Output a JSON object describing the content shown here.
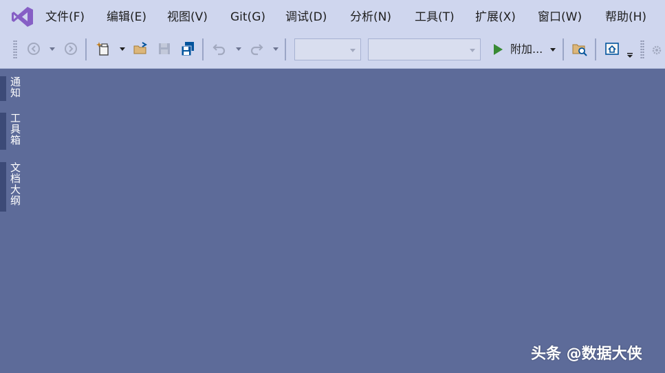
{
  "menu": [
    {
      "id": "file",
      "label": "文件(F)"
    },
    {
      "id": "edit",
      "label": "编辑(E)"
    },
    {
      "id": "view",
      "label": "视图(V)"
    },
    {
      "id": "git",
      "label": "Git(G)"
    },
    {
      "id": "debug",
      "label": "调试(D)"
    },
    {
      "id": "analyze",
      "label": "分析(N)"
    },
    {
      "id": "tools",
      "label": "工具(T)"
    },
    {
      "id": "extensions",
      "label": "扩展(X)"
    },
    {
      "id": "window",
      "label": "窗口(W)"
    },
    {
      "id": "help",
      "label": "帮助(H)"
    }
  ],
  "toolbar": {
    "attach_label": "附加...",
    "solution_config_value": "",
    "solution_platform_value": ""
  },
  "side_tabs": [
    {
      "id": "notifications",
      "label": "通知"
    },
    {
      "id": "toolbox",
      "label": "工具箱"
    },
    {
      "id": "document-outline",
      "label": "文档大纲"
    }
  ],
  "watermark": "头条 @数据大侠",
  "colors": {
    "chrome": "#cfd6ee",
    "workspace": "#5d6b99",
    "side_tab": "#3c4a77",
    "vs_purple": "#865fc5",
    "play_green": "#388a34",
    "save_blue": "#00539c",
    "folder_orange": "#dcb67a"
  },
  "icons": {
    "app_logo": "visual-studio-logo-icon",
    "back": "navigate-back-icon",
    "forward": "navigate-forward-icon",
    "new_project": "new-project-icon",
    "open": "open-folder-icon",
    "save": "save-icon",
    "save_all": "save-all-icon",
    "undo": "undo-icon",
    "redo": "redo-icon",
    "start": "start-play-icon",
    "find_in_files": "find-in-files-icon",
    "home": "home-icon"
  }
}
